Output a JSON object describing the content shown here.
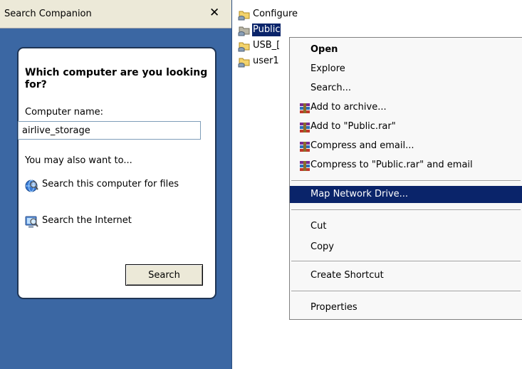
{
  "pane": {
    "title": "Search Companion",
    "close_glyph": "✕",
    "question": "Which computer are you looking for?",
    "computer_name_label": "Computer name:",
    "computer_name_value": "airlive_storage",
    "also_label": "You may also want to...",
    "links": [
      {
        "label": "Search this computer for files",
        "icon": "search-computer-icon"
      },
      {
        "label": "Search the Internet",
        "icon": "search-internet-icon"
      }
    ],
    "search_button": "Search"
  },
  "files": [
    {
      "name": "Configure",
      "icon": "shared-folder-icon"
    },
    {
      "name": "Public",
      "icon": "shared-folder-icon",
      "selected": true
    },
    {
      "name": "USB_[",
      "icon": "shared-folder-icon"
    },
    {
      "name": "user1",
      "icon": "shared-folder-icon"
    }
  ],
  "context_menu": {
    "items": [
      {
        "label": "Open",
        "bold": true
      },
      {
        "label": "Explore"
      },
      {
        "label": "Search..."
      },
      {
        "label": "Add to archive...",
        "icon": "winrar-icon"
      },
      {
        "label": "Add to \"Public.rar\"",
        "icon": "winrar-icon"
      },
      {
        "label": "Compress and email...",
        "icon": "winrar-icon"
      },
      {
        "label": "Compress to \"Public.rar\" and email",
        "icon": "winrar-icon"
      },
      {
        "label": "Map Network Drive...",
        "highlighted": true
      },
      {
        "label": "Cut"
      },
      {
        "label": "Copy"
      },
      {
        "label": "Create Shortcut"
      },
      {
        "label": "Properties"
      }
    ]
  },
  "colors": {
    "pane_background": "#3b67a3",
    "selection": "#0a246a",
    "menu_background": "#f8f8f8"
  }
}
